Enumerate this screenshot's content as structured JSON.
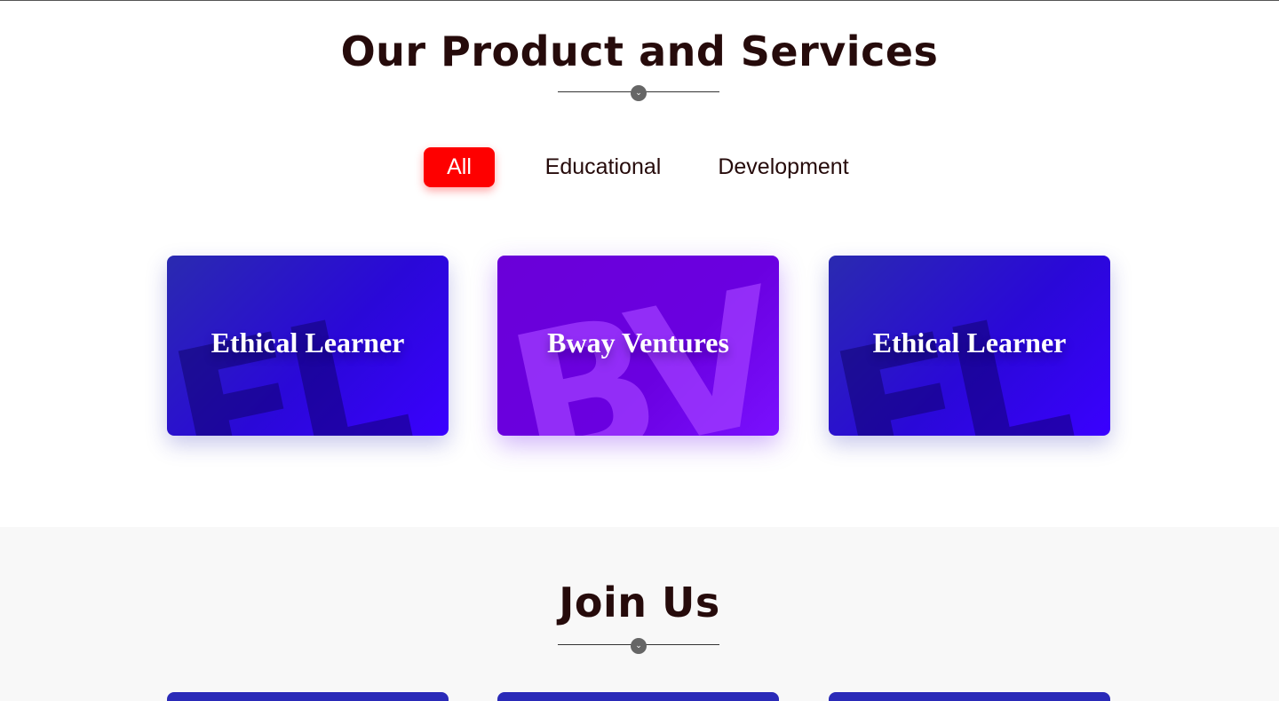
{
  "products_section": {
    "title": "Our Product and Services",
    "divider_icon": "chevron-down-icon",
    "filters": [
      {
        "label": "All",
        "active": true
      },
      {
        "label": "Educational",
        "active": false
      },
      {
        "label": "Development",
        "active": false
      }
    ],
    "cards": [
      {
        "title": "Ethical Learner",
        "watermark": "EL"
      },
      {
        "title": "Bway Ventures",
        "watermark": "BV"
      },
      {
        "title": "Ethical Learner",
        "watermark": "EL"
      }
    ]
  },
  "join_section": {
    "title": "Join Us",
    "divider_icon": "chevron-down-icon"
  },
  "colors": {
    "accent": "#fe0000",
    "heading": "#260b0b",
    "card_blue": "#2a08d8",
    "card_purple": "#6a00e0",
    "section_gray": "#f8f8f8"
  }
}
